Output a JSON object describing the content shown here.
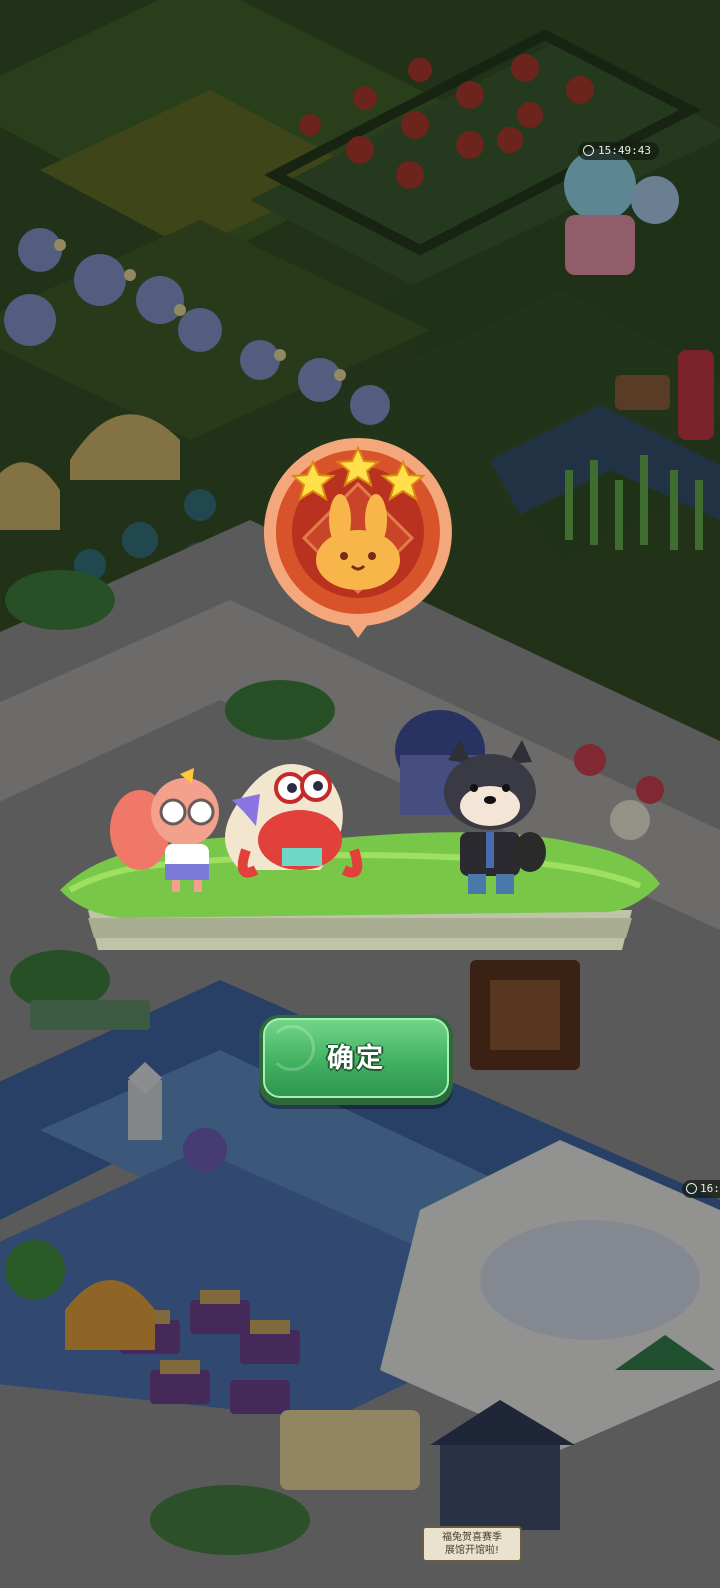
{
  "screen": {
    "timer_top": "15:49:43",
    "timer_side": "16:",
    "sign_text": "福兔贺喜赛季\n展馆开馆啦!",
    "badge": {
      "stars": 3
    },
    "confirm_button_label": "确定"
  }
}
